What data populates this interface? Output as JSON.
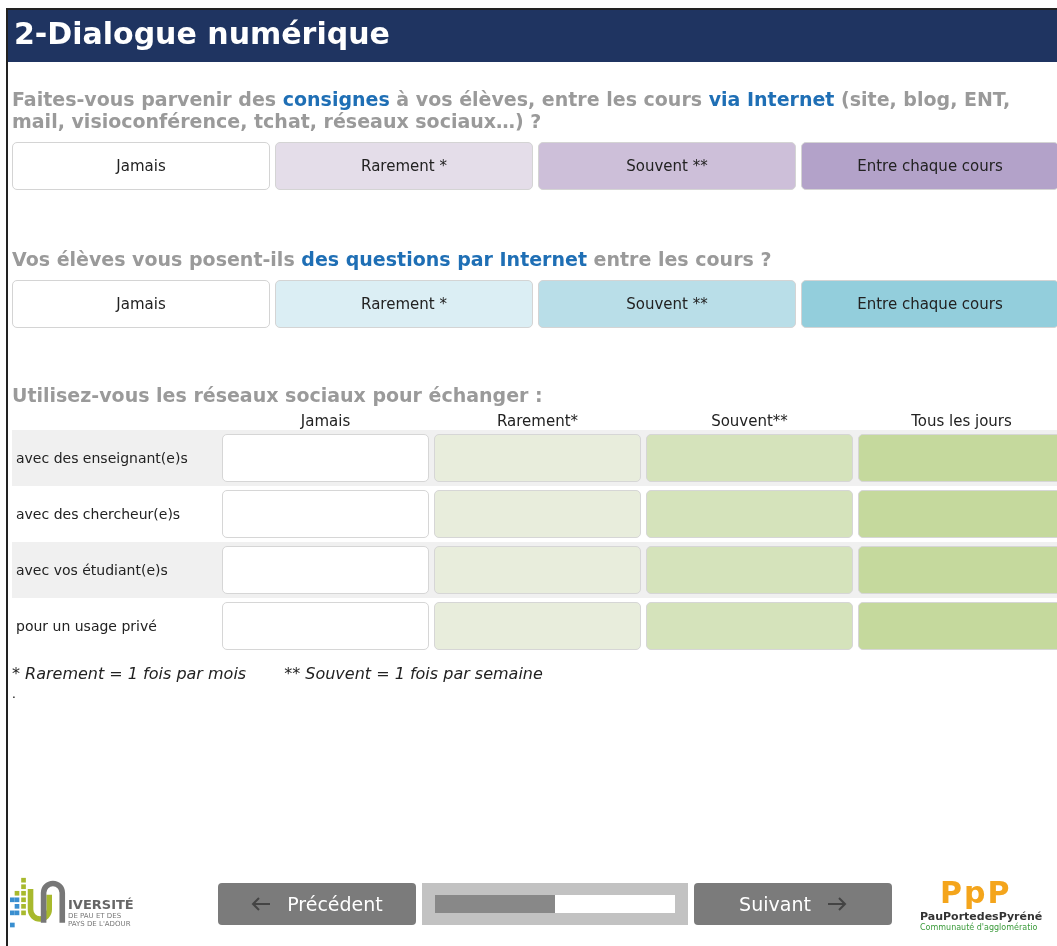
{
  "header": {
    "title": "2-Dialogue numérique"
  },
  "questions": [
    {
      "parts": [
        {
          "text": "Faites-vous parvenir des ",
          "highlight": false
        },
        {
          "text": "consignes",
          "highlight": true
        },
        {
          "text": " à vos élèves, entre les cours ",
          "highlight": false
        },
        {
          "text": "via Internet",
          "highlight": true
        },
        {
          "text": " (site, blog, ENT, mail, visioconférence, tchat, réseaux sociaux…) ?",
          "highlight": false
        }
      ],
      "options": [
        {
          "label": "Jamais",
          "selected": false,
          "color": "#ffffff"
        },
        {
          "label": "Rarement *",
          "selected": false,
          "color": "#e4dde9"
        },
        {
          "label": "Souvent **",
          "selected": false,
          "color": "#cdbfd9"
        },
        {
          "label": "Entre chaque cours",
          "selected": false,
          "color": "#b3a2c9"
        }
      ]
    },
    {
      "parts": [
        {
          "text": "Vos élèves vous posent-ils ",
          "highlight": false
        },
        {
          "text": "des questions par Internet",
          "highlight": true
        },
        {
          "text": " entre les cours ?",
          "highlight": false
        }
      ],
      "options": [
        {
          "label": "Jamais",
          "selected": false,
          "color": "#ffffff"
        },
        {
          "label": "Rarement *",
          "selected": false,
          "color": "#dbeef4"
        },
        {
          "label": "Souvent **",
          "selected": false,
          "color": "#b9dee8"
        },
        {
          "label": "Entre chaque cours",
          "selected": false,
          "color": "#93cedc"
        }
      ]
    }
  ],
  "matrix": {
    "title": "Utilisez-vous les réseaux sociaux pour échanger :",
    "columns": [
      {
        "label": "Jamais",
        "color": "#ffffff"
      },
      {
        "label": "Rarement*",
        "color": "#e8eddc"
      },
      {
        "label": "Souvent**",
        "color": "#d5e3bb"
      },
      {
        "label": "Tous les jours",
        "color": "#c5d99d"
      }
    ],
    "rows": [
      {
        "label": "avec des enseignant(e)s",
        "selected": [
          false,
          false,
          false,
          false
        ]
      },
      {
        "label": "avec des chercheur(e)s",
        "selected": [
          false,
          false,
          false,
          false
        ]
      },
      {
        "label": "avec vos étudiant(e)s",
        "selected": [
          false,
          false,
          false,
          false
        ]
      },
      {
        "label": "pour un usage privé",
        "selected": [
          false,
          false,
          false,
          false
        ]
      }
    ]
  },
  "footnotes": [
    "* Rarement = 1 fois par mois",
    "** Souvent = 1 fois par semaine"
  ],
  "stray_mark": ".",
  "navigation": {
    "previous": "Précédent",
    "next": "Suivant",
    "progress": {
      "level": 0.5
    }
  },
  "logos": {
    "left": {
      "line_1": "IVERSITÉ",
      "line_2": "DE PAU ET DES",
      "line_3": "PAYS DE L'ADOUR"
    },
    "right": {
      "mark": "PpP",
      "name": "PauPortedesPyréné",
      "tagline": "Communauté d'agglomératio"
    }
  }
}
